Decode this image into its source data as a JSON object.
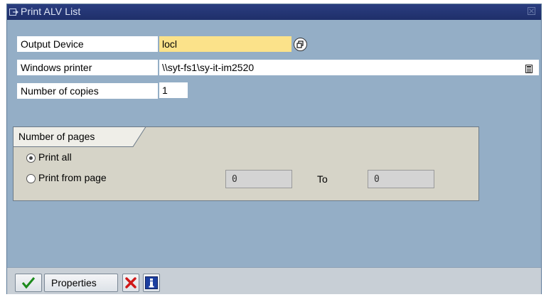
{
  "window": {
    "title": "Print ALV List"
  },
  "form": {
    "output_device": {
      "label": "Output Device",
      "value": "locl"
    },
    "windows_printer": {
      "label": "Windows printer",
      "value": "\\\\syt-fs1\\sy-it-im2520"
    },
    "copies": {
      "label": "Number of copies",
      "value": "1"
    }
  },
  "pages": {
    "group_title": "Number of pages",
    "print_all": {
      "label": "Print all",
      "selected": true
    },
    "print_from": {
      "label": "Print from page",
      "selected": false
    },
    "from_value": "0",
    "to_label": "To",
    "to_value": "0"
  },
  "footer": {
    "properties_label": "Properties"
  },
  "colors": {
    "title_bar": "#1f2f6a",
    "window_bg": "#94aec6",
    "required_field": "#fbe28a",
    "group_bg": "#d6d4c8"
  },
  "icons": [
    "window-icon",
    "close-icon",
    "match-help-icon",
    "document-icon",
    "check-icon",
    "cancel-icon",
    "info-icon"
  ]
}
